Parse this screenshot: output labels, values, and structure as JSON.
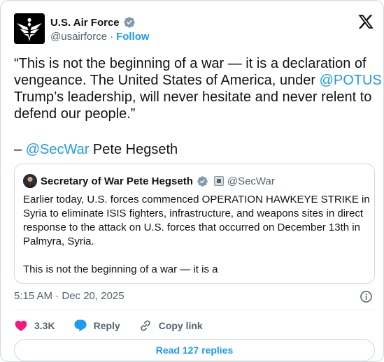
{
  "author": {
    "name": "U.S. Air Force",
    "handle": "@usairforce",
    "separator": "·",
    "follow_label": "Follow"
  },
  "tweet": {
    "lines": [
      {
        "before": "“This is not the beginning of a war — it is a declaration of",
        "mention": "",
        "after": ""
      },
      {
        "before": "vengeance. The United States of America, under ",
        "mention": "@POTUS",
        "after": ""
      },
      {
        "before": "Trump’s leadership, will never hesitate and never relent to",
        "mention": "",
        "after": ""
      },
      {
        "before": "defend our people.”",
        "mention": "",
        "after": ""
      }
    ],
    "signature_prefix": "– ",
    "signature_mention": "@SecWar",
    "signature_suffix": " Pete Hegseth"
  },
  "quote": {
    "name": "Secretary of War Pete Hegseth",
    "handle": "@SecWar",
    "lines": [
      "Earlier today, U.S. forces commenced OPERATION HAWKEYE STRIKE in",
      "Syria to eliminate ISIS fighters, infrastructure, and weapons sites in direct",
      "response to the attack on U.S. forces that occurred on December 13th in",
      "Palmyra, Syria."
    ],
    "truncated_line": "This is not the beginning of a war — it is a"
  },
  "meta": {
    "timestamp": "5:15 AM · Dec 20, 2025"
  },
  "actions": {
    "like_count": "3.3K",
    "reply_label": "Reply",
    "copy_link_label": "Copy link"
  },
  "read_replies_label": "Read 127 replies",
  "colors": {
    "accent": "#1d9bf0",
    "verified": "#829aab",
    "like": "#f91880",
    "text": "#0f1419",
    "secondary": "#536471"
  },
  "icons": {
    "author_avatar": "air-force-wings-logo",
    "verified": "verified-badge-icon",
    "x_logo": "x-logo-icon",
    "info": "info-icon",
    "like": "heart-icon",
    "reply": "speech-bubble-icon",
    "copy_link": "link-icon"
  }
}
